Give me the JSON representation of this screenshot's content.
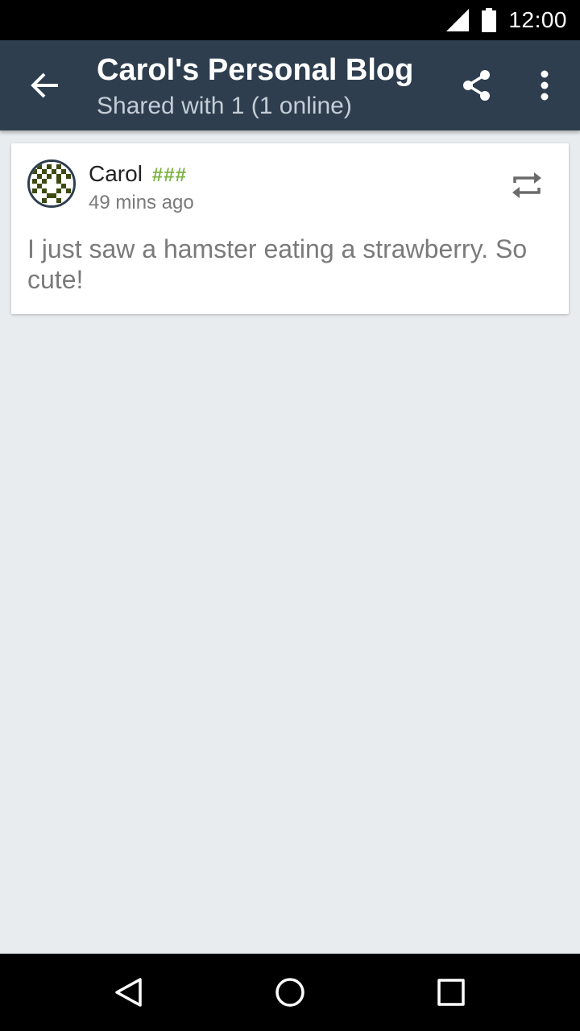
{
  "status_bar": {
    "time": "12:00",
    "icons": [
      "signal-icon",
      "battery-icon"
    ]
  },
  "app_bar": {
    "title": "Carol's Personal Blog",
    "subtitle": "Shared with 1 (1 online)",
    "icons": [
      "back-arrow-icon",
      "share-icon",
      "more-vert-icon"
    ],
    "background_color": "#2e3e4f"
  },
  "post": {
    "author": "Carol",
    "author_id": "###",
    "author_id_color": "#7cb342",
    "time": "49 mins ago",
    "body": "I just saw a hamster eating a strawberry. So cute!",
    "icons": [
      "avatar-identicon",
      "reshare-icon"
    ]
  },
  "nav_bar": {
    "icons": [
      "back-triangle-icon",
      "home-circle-icon",
      "recents-square-icon"
    ]
  },
  "colors": {
    "page_background": "#e8ecef",
    "app_bar": "#2e3e4f",
    "secondary_text": "#7a7a7a"
  }
}
